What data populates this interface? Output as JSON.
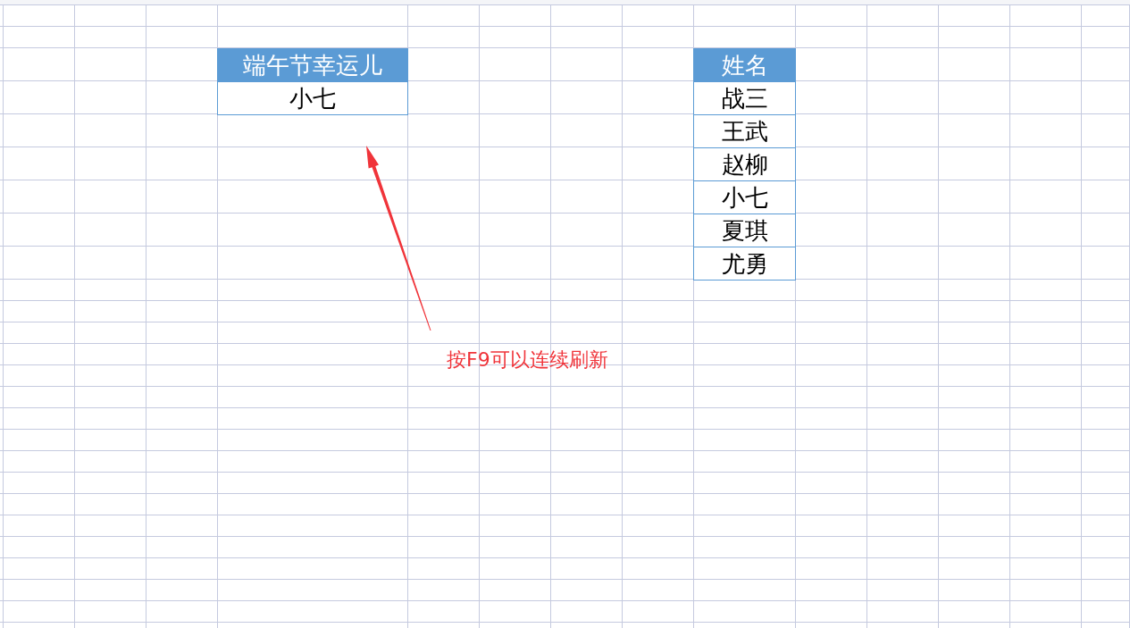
{
  "tables": [
    {
      "header": "端午节幸运儿",
      "cells": [
        "小七"
      ]
    },
    {
      "header": "姓名",
      "cells": [
        "战三",
        "王武",
        "赵柳",
        "小七",
        "夏琪",
        "尤勇"
      ]
    }
  ],
  "annotation": {
    "text": "按F9可以连续刷新"
  }
}
